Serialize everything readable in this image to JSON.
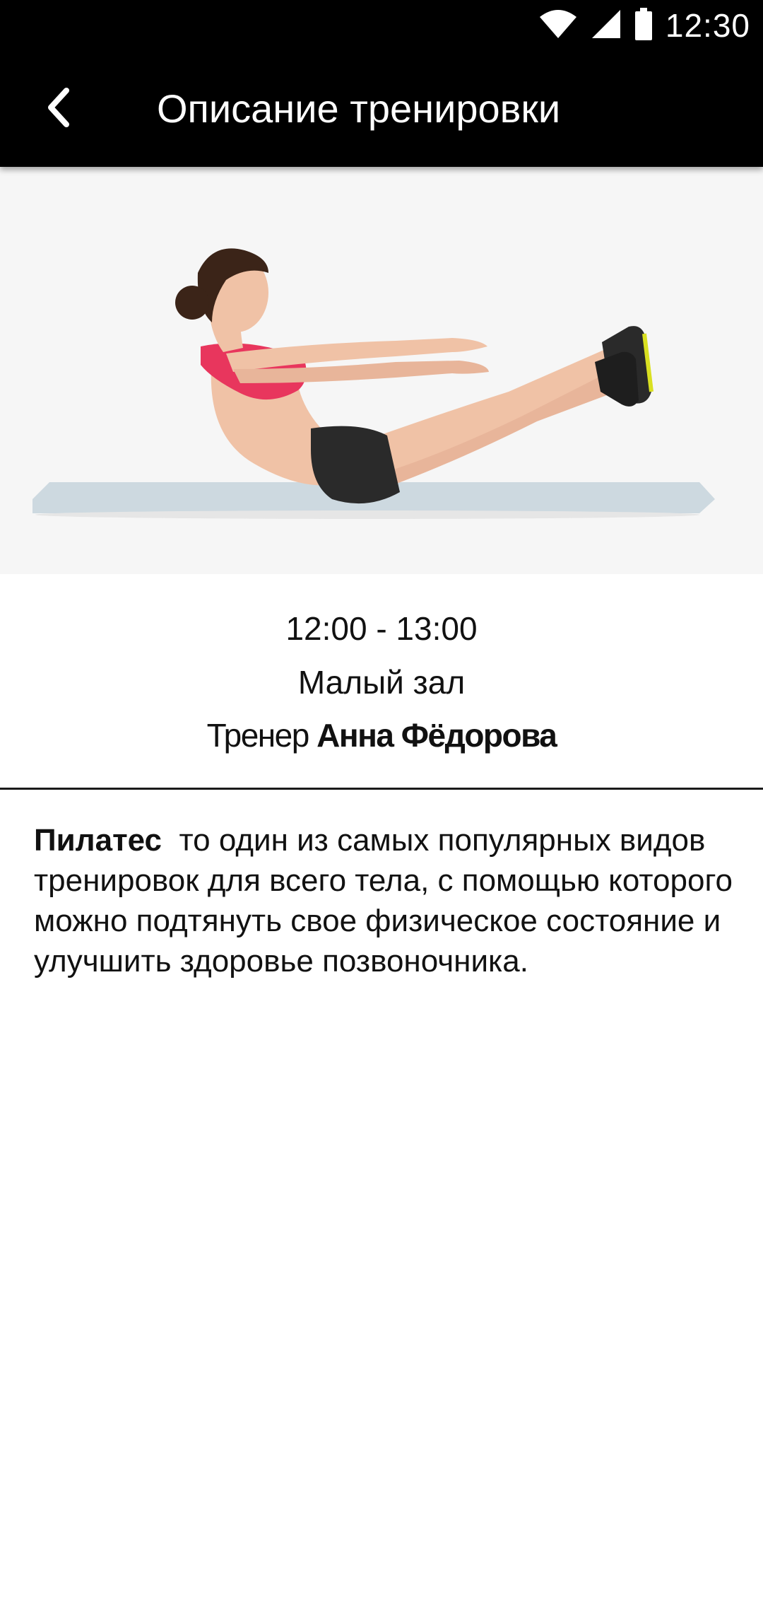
{
  "status_bar": {
    "time": "12:30",
    "icons": [
      "wifi-icon",
      "cell-signal-icon",
      "battery-icon"
    ]
  },
  "app_bar": {
    "title": "Описание тренировки",
    "back_icon": "chevron-left-icon"
  },
  "hero": {
    "image": "pilates-v-sit-photo"
  },
  "info": {
    "time": "12:00 - 13:00",
    "room": "Малый зал",
    "trainer_label": "Тренер",
    "trainer_name": "Анна Фёдорова"
  },
  "description": {
    "title": "Пилатес",
    "text": "то один из самых популярных видов тренировок для всего тела, с помощью  которого можно подтянуть свое физическое состояние и улучшить здоровье позвоночника."
  },
  "colors": {
    "bar_background": "#000000",
    "hero_background": "#f6f6f6",
    "top_color": "#e8365d",
    "shorts_color": "#2a2a2a",
    "mat_color": "#cdd9e0",
    "shoe_accent": "#d9e021"
  }
}
